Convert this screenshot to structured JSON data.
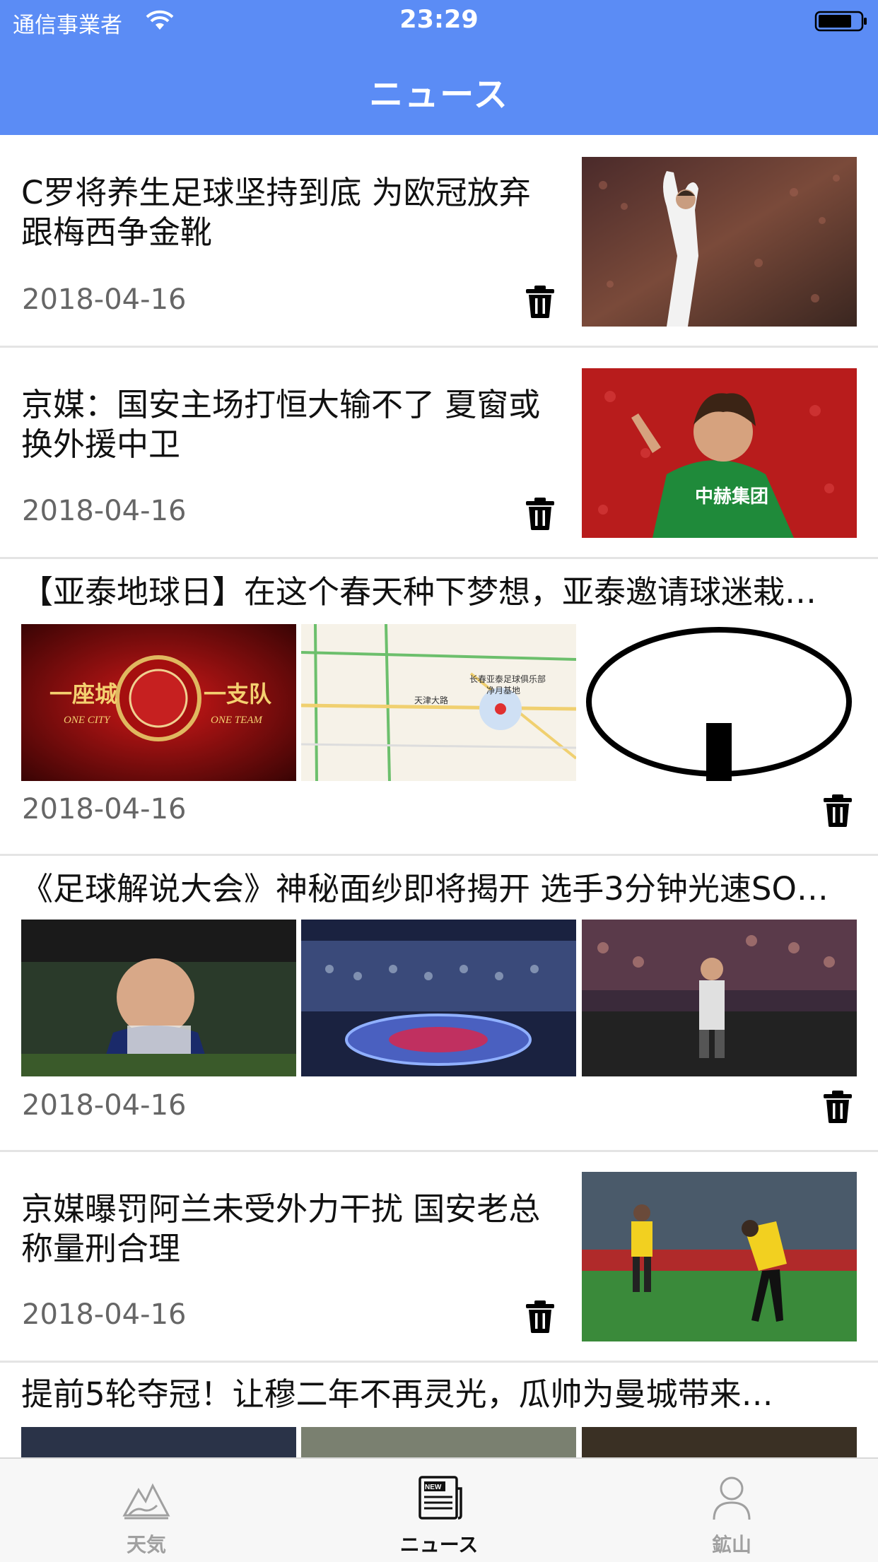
{
  "status": {
    "carrier": "通信事業者",
    "time": "23:29"
  },
  "nav": {
    "title": "ニュース"
  },
  "colors": {
    "accent": "#5b8cf5",
    "tab_active": "#111111",
    "tab_inactive": "#a0a0a0"
  },
  "news": [
    {
      "title": "C罗将养生足球坚持到底 为欧冠放弃跟梅西争金靴",
      "date": "2018-04-16"
    },
    {
      "title": "京媒：国安主场打恒大输不了 夏窗或换外援中卫",
      "date": "2018-04-16"
    },
    {
      "title": "【亚泰地球日】在这个春天种下梦想，亚泰邀请球迷栽…",
      "date": "2018-04-16"
    },
    {
      "title": "《足球解说大会》神秘面纱即将揭开 选手3分钟光速SO…",
      "date": "2018-04-16"
    },
    {
      "title": "京媒曝罚阿兰未受外力干扰 国安老总称量刑合理",
      "date": "2018-04-16"
    },
    {
      "title": "提前5轮夺冠！让穆二年不再灵光，瓜帅为曼城带来…",
      "date": ""
    }
  ],
  "image_text": {
    "team_logo_left": "一座城",
    "team_logo_left_sub": "ONE CITY",
    "team_logo_right": "一支队",
    "team_logo_right_sub": "ONE TEAM",
    "jersey": "中赫集团",
    "map_label_1": "长春亚泰足球俱乐部",
    "map_label_2": "净月基地",
    "map_road": "天津大路"
  },
  "tabs": [
    {
      "label": "天気",
      "icon": "mountain-icon"
    },
    {
      "label": "ニュース",
      "icon": "newspaper-icon"
    },
    {
      "label": "鉱山",
      "icon": "person-icon"
    }
  ]
}
